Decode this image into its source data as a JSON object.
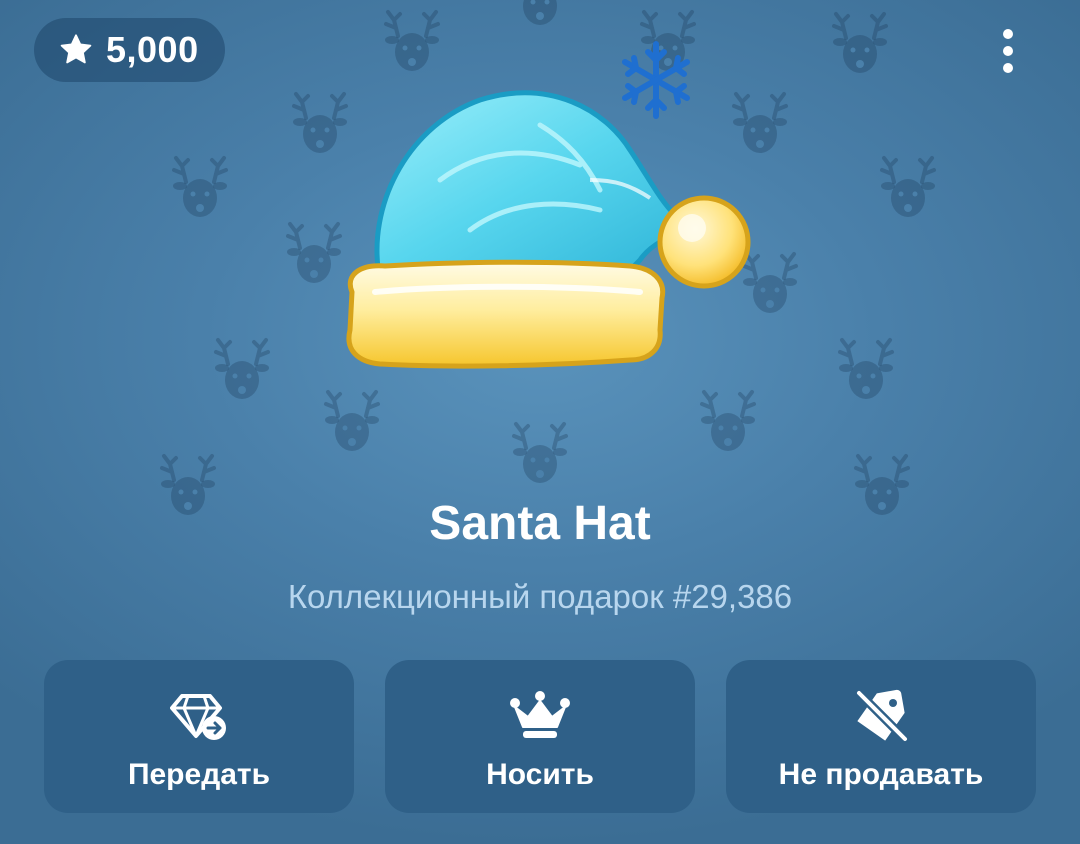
{
  "header": {
    "price_icon": "star-icon",
    "price_value": "5,000",
    "menu_icon": "more-vertical-icon"
  },
  "gift": {
    "name": "Santa Hat",
    "subtitle": "Коллекционный подарок #29,386",
    "image": "santa-hat-icon",
    "pattern_icon": "reindeer-icon",
    "background_color": "#4a80aa"
  },
  "actions": [
    {
      "label": "Передать",
      "icon": "diamond-transfer-icon"
    },
    {
      "label": "Носить",
      "icon": "crown-icon"
    },
    {
      "label": "Не продавать",
      "icon": "tag-off-icon"
    }
  ]
}
